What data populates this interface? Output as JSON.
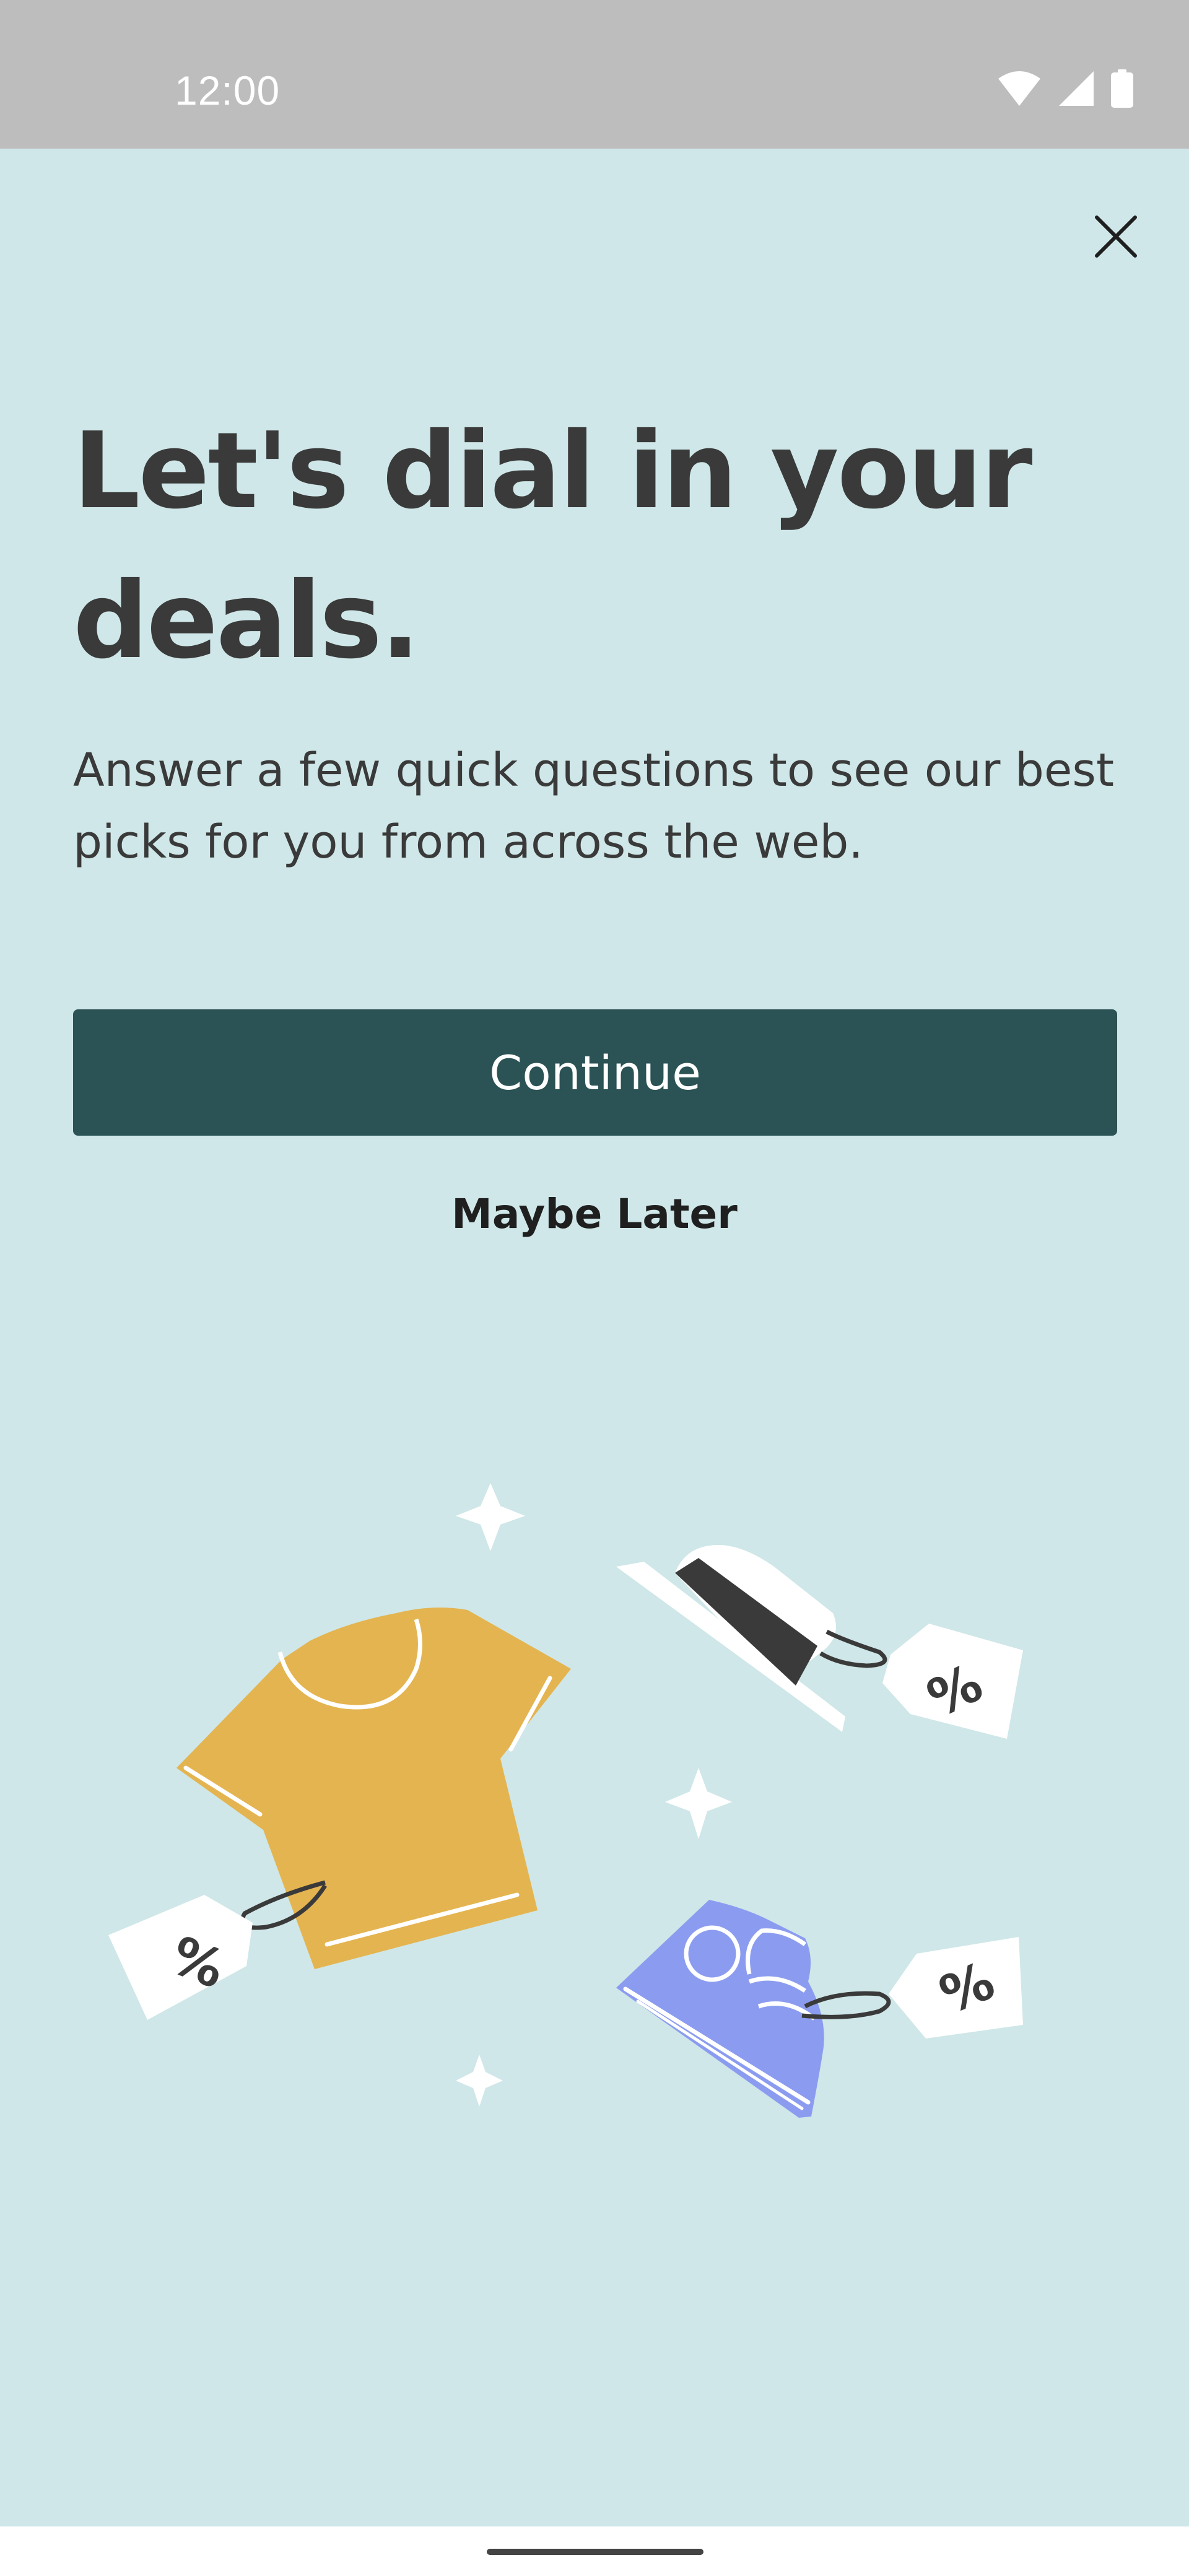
{
  "status_bar": {
    "time": "12:00",
    "icons": [
      "wifi-icon",
      "cellular-signal-icon",
      "battery-icon"
    ]
  },
  "dialog": {
    "close_icon": "close-icon",
    "title": "Let's dial in your deals.",
    "subtitle": "Answer a few quick questions to see our best picks for you from across the web.",
    "continue_label": "Continue",
    "maybe_later_label": "Maybe Later"
  },
  "illustration": {
    "items": [
      "t-shirt",
      "hat",
      "sneaker",
      "price-tags",
      "sparkles"
    ],
    "tag_text": "%"
  },
  "colors": {
    "background": "#CFE7E8",
    "status_bar": "#BDBDBD",
    "primary_button": "#2B5254",
    "text": "#3A3A3A",
    "shirt": "#E4B450",
    "sneaker": "#8B9CF0",
    "hat_band": "#3A3A3A"
  }
}
